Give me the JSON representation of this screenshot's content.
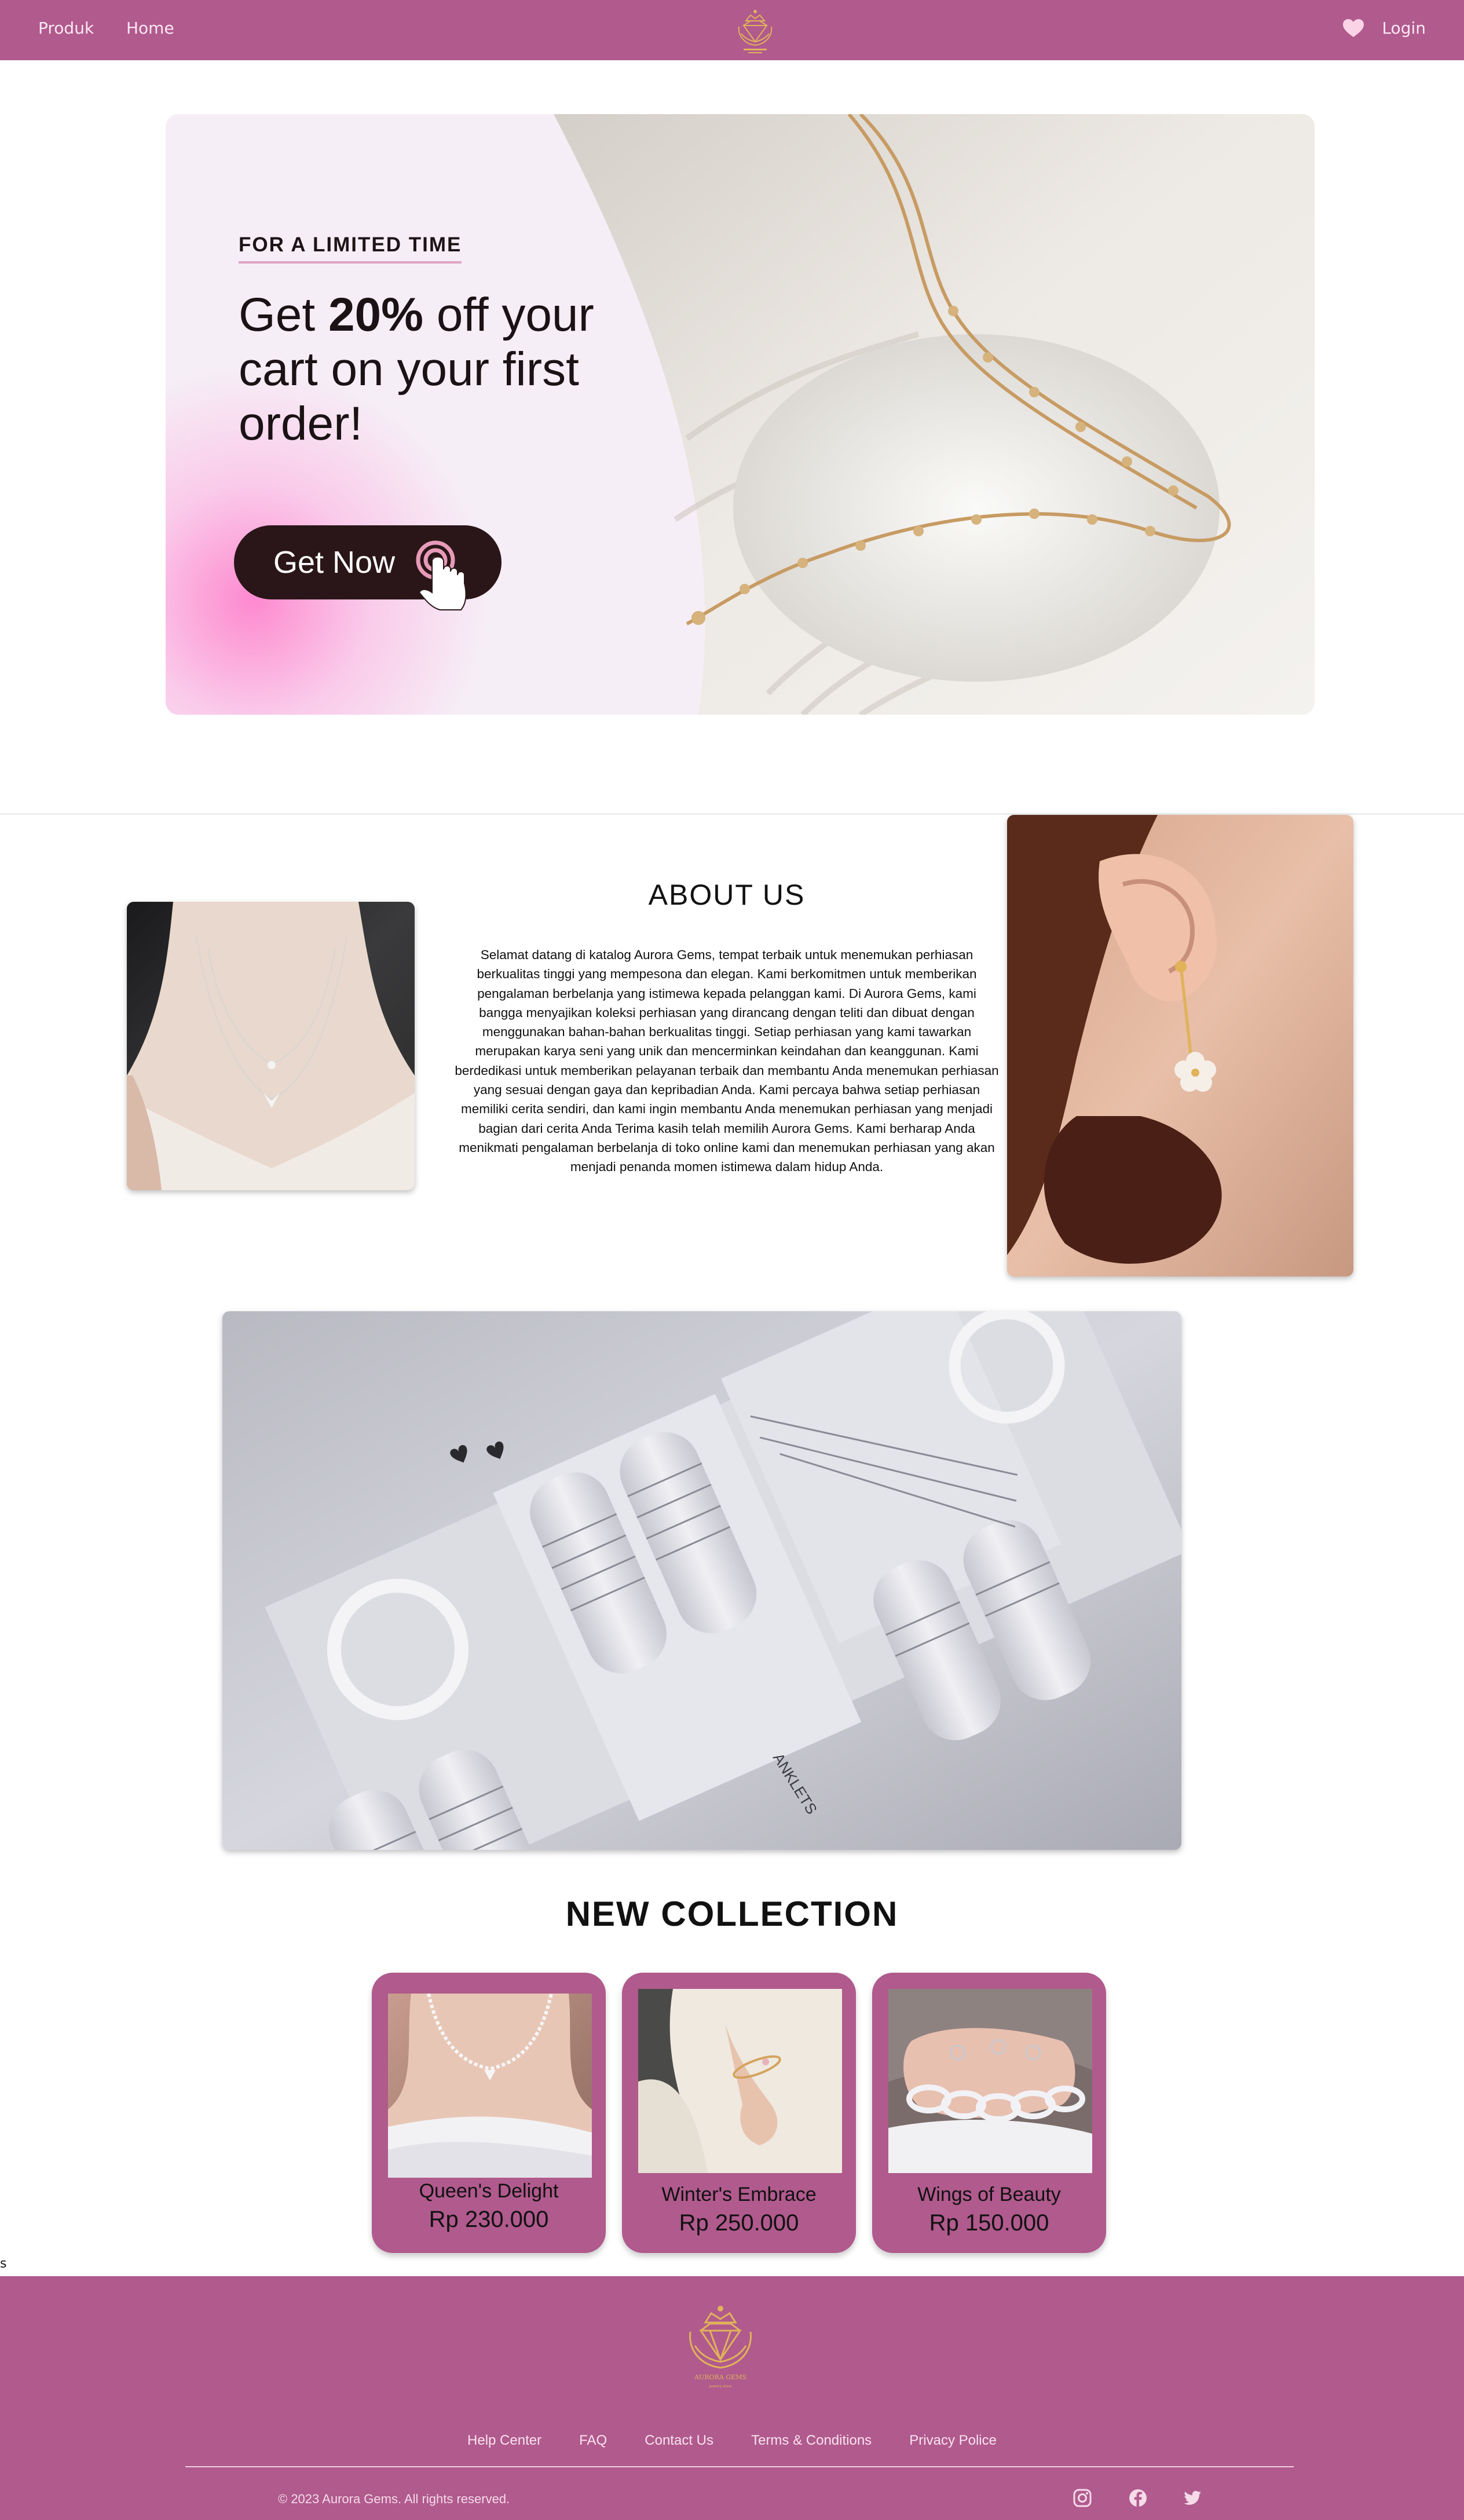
{
  "nav": {
    "left_links": [
      "Produk",
      "Home"
    ],
    "login": "Login",
    "logo_icon": "aurora-gems-crest-icon",
    "heart_icon": "heart-icon"
  },
  "hero": {
    "kicker": "FOR A LIMITED TIME",
    "headline_pre": "Get ",
    "headline_bold": "20%",
    "headline_post": " off your cart on your first order!",
    "cta": "Get Now",
    "cta_icon": "tap-pointer-icon",
    "image": "gold bracelet on knit fabric"
  },
  "about": {
    "title": "ABOUT US",
    "text": "Selamat datang di katalog Aurora Gems, tempat terbaik untuk menemukan perhiasan berkualitas tinggi yang mempesona dan elegan. Kami berkomitmen untuk memberikan pengalaman berbelanja yang istimewa kepada pelanggan kami. Di Aurora Gems, kami bangga menyajikan koleksi perhiasan yang dirancang dengan teliti dan dibuat dengan menggunakan bahan-bahan berkualitas tinggi. Setiap perhiasan yang kami tawarkan merupakan karya seni yang unik dan mencerminkan keindahan dan keanggunan. Kami berdedikasi untuk memberikan pelayanan terbaik dan membantu Anda menemukan perhiasan yang sesuai dengan gaya dan kepribadian Anda. Kami percaya bahwa setiap perhiasan memiliki cerita sendiri, dan kami ingin membantu Anda menemukan perhiasan yang menjadi bagian dari cerita Anda Terima kasih telah memilih Aurora Gems. Kami berharap Anda menikmati pengalaman berbelanja di toko online kami dan menemukan perhiasan yang akan menjadi penanda momen istimewa dalam hidup Anda."
  },
  "showcase": {
    "tray_label": "ANKLETS"
  },
  "collection": {
    "title": "NEW COLLECTION",
    "items": [
      {
        "name": "Queen's Delight",
        "price": "Rp 230.000"
      },
      {
        "name": "Winter's Embrace",
        "price": "Rp 250.000"
      },
      {
        "name": "Wings of Beauty",
        "price": "Rp 150.000"
      }
    ]
  },
  "stray_text": "s",
  "footer": {
    "brand": "AURORA GEMS",
    "brand_sub": "jewelry store",
    "links": [
      "Help Center",
      "FAQ",
      "Contact Us",
      "Terms & Conditions",
      "Privacy Police"
    ],
    "copyright": "© 2023 Aurora Gems. All rights reserved.",
    "social_icons": [
      "instagram-icon",
      "facebook-icon",
      "twitter-icon"
    ]
  },
  "colors": {
    "brand": "#b05a8d",
    "cta_dark": "#2a1618",
    "gold": "#e0b25a",
    "hero_bg": "#f6eef6"
  }
}
